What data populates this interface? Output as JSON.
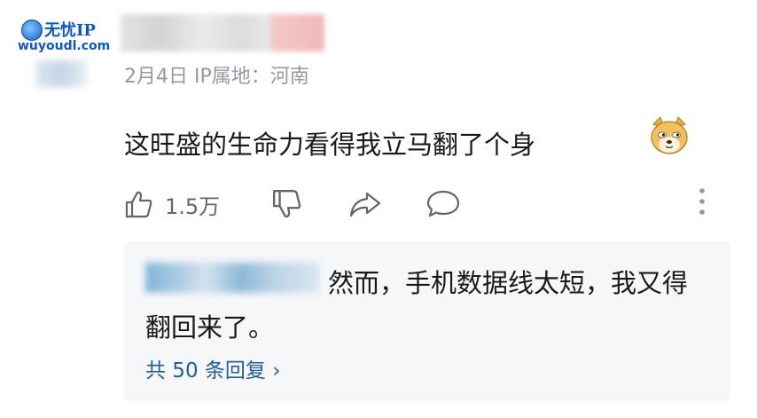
{
  "watermark": {
    "title": "无忧IP",
    "url": "wuyoudl.com"
  },
  "comment": {
    "date_location": "2月4日 IP属地：河南",
    "text": "这旺盛的生命力看得我立马翻了个身",
    "like_count": "1.5万"
  },
  "reply_preview": {
    "text": "然而，手机数据线太短，我又得翻回来了。",
    "total_replies_label": "共 50 条回复 ›"
  },
  "icons": [
    "thumbs-up-icon",
    "thumbs-down-icon",
    "share-icon",
    "comment-icon",
    "more-vertical-icon",
    "doge-emoji-icon"
  ],
  "colors": {
    "link": "#1e5e9a",
    "muted": "#9499a0",
    "text": "#18191c",
    "reply_bg": "#f6f7f8"
  }
}
